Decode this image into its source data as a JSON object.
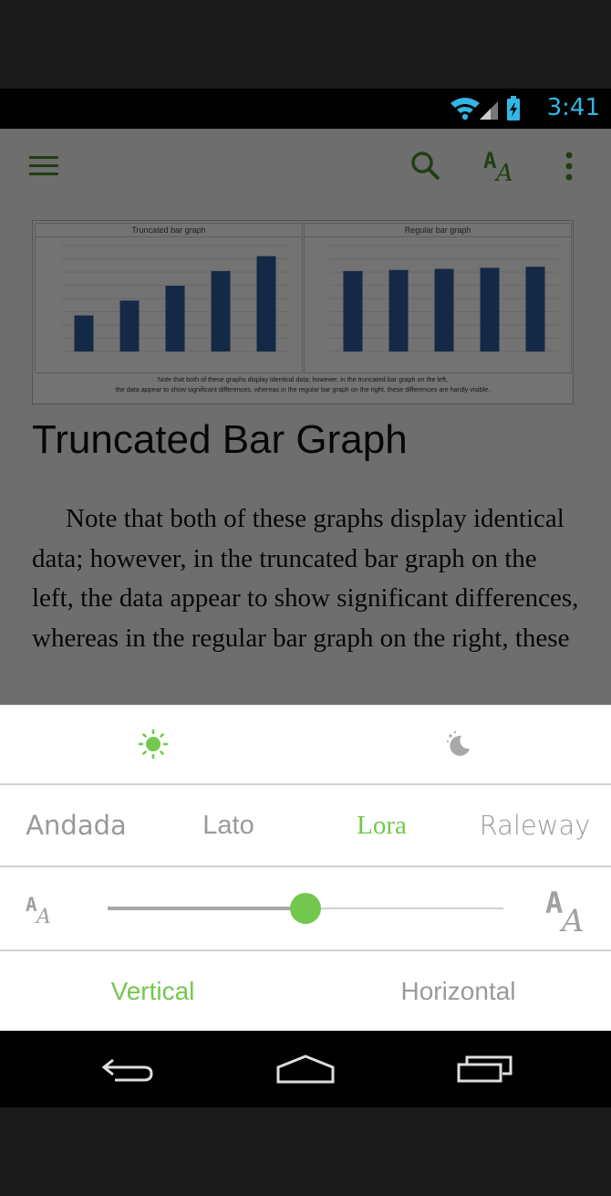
{
  "status": {
    "time": "3:41"
  },
  "toolbar": {
    "menu_icon": "hamburger-icon",
    "search_icon": "search-icon",
    "text_settings_icon": "font-size-icon",
    "overflow_icon": "more-vert-icon",
    "accent": "#4a8a2c"
  },
  "figure": {
    "left_title": "Truncated bar graph",
    "right_title": "Regular bar graph",
    "note_line1": "Note that both of these graphs display identical data; however, in the truncated bar graph on the left,",
    "note_line2": "the data appear to show significant differences, whereas in the regular bar graph on the right, these differences are hardly visible.",
    "left_values": [
      34,
      48,
      62,
      76,
      90
    ],
    "right_values": [
      76,
      77,
      78,
      79,
      80
    ]
  },
  "article": {
    "title": "Truncated Bar Graph",
    "body": "Note that both of these graphs display identical data; however, in the truncated bar graph on the left, the data appear to show significant differences, whereas in the regular bar graph on the right, these"
  },
  "settings": {
    "themes": [
      {
        "icon": "sun-icon",
        "selected": true
      },
      {
        "icon": "moon-icon",
        "selected": false
      }
    ],
    "fonts": [
      {
        "label": "Andada",
        "selected": false
      },
      {
        "label": "Lato",
        "selected": false
      },
      {
        "label": "Lora",
        "selected": true
      },
      {
        "label": "Raleway",
        "selected": false
      }
    ],
    "font_size_fraction": 0.5,
    "orientation": [
      {
        "label": "Vertical",
        "selected": true
      },
      {
        "label": "Horizontal",
        "selected": false
      }
    ],
    "accent": "#74c74e"
  },
  "navbar": {
    "back_icon": "back-icon",
    "home_icon": "home-icon",
    "recents_icon": "recents-icon"
  }
}
